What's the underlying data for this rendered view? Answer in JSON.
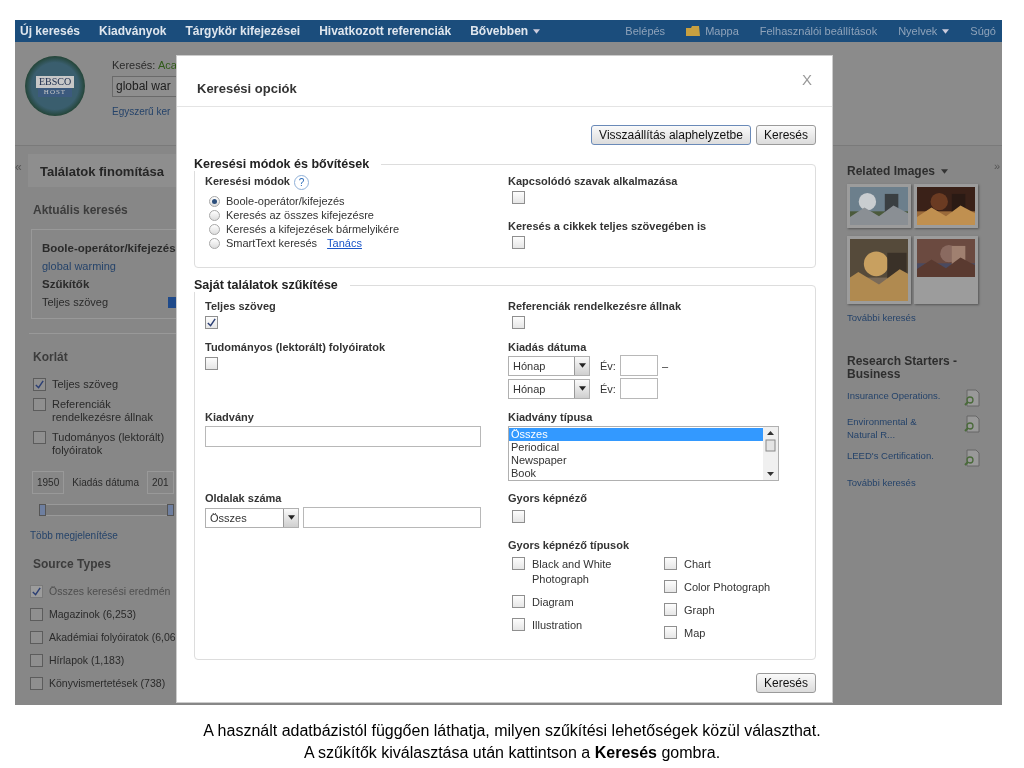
{
  "nav": {
    "left": [
      {
        "label": "Új keresés",
        "kind": "link"
      },
      {
        "label": "Kiadványok",
        "kind": "link"
      },
      {
        "label": "Tárgykör kifejezései",
        "kind": "link"
      },
      {
        "label": "Hivatkozott referenciák",
        "kind": "link"
      },
      {
        "label": "Bővebben",
        "kind": "menu"
      }
    ],
    "right": [
      {
        "label": "Belépés",
        "kind": "link"
      },
      {
        "label": "Mappa",
        "kind": "folder"
      },
      {
        "label": "Felhasználói beállítások",
        "kind": "link"
      },
      {
        "label": "Nyelvek",
        "kind": "menu"
      },
      {
        "label": "Súgó",
        "kind": "link"
      }
    ]
  },
  "header": {
    "logo": {
      "top": "EBSCO",
      "bottom": "HOST"
    },
    "search_label": "Keresés:",
    "database": "Aca",
    "query": "global war",
    "basic_link": "Egyszerű ker"
  },
  "sidebar": {
    "collapse": "«",
    "title": "Találatok finomítása",
    "current": {
      "heading": "Aktuális keresés",
      "mode": "Boole-operátor/kifejezés",
      "query": "global warming",
      "limiters_heading": "Szűkítők",
      "limiter": "Teljes szöveg"
    },
    "limit": {
      "heading": "Korlát",
      "items": [
        {
          "label": "Teljes szöveg",
          "checked": true
        },
        {
          "label": "Referenciák rendelkezésre állnak",
          "checked": false
        },
        {
          "label": "Tudományos (lektorált) folyóiratok",
          "checked": false
        }
      ],
      "date": {
        "from": "1950",
        "label": "Kiadás dátuma",
        "to": "201",
        "level": 1
      },
      "more": "Több megjelenítése"
    },
    "source_types": {
      "heading": "Source Types",
      "items": [
        {
          "label": "Összes keresési eredmén",
          "checked": true,
          "disabled": true
        },
        {
          "label": "Magazinok (6,253)",
          "checked": false,
          "disabled": false
        },
        {
          "label": "Akadémiai folyóiratok (6,06",
          "checked": false,
          "disabled": false
        },
        {
          "label": "Hírlapok (1,183)",
          "checked": false,
          "disabled": false
        },
        {
          "label": "Könyvismertetések (738)",
          "checked": false,
          "disabled": false
        }
      ]
    }
  },
  "right_panel": {
    "expand": "»",
    "related": {
      "heading": "Related Images",
      "more": "További keresés"
    },
    "starters": {
      "heading": "Research Starters - Business",
      "items": [
        {
          "label": "Insurance Operations."
        },
        {
          "label": "Environmental & Natural R..."
        },
        {
          "label": "LEED's Certification."
        }
      ],
      "more": "További keresés"
    }
  },
  "modal": {
    "title": "Keresési opciók",
    "close": "X",
    "reset_button": "Visszaállítás alaphelyzetbe",
    "search_button": "Keresés",
    "modes_section": {
      "legend": "Keresési módok és bővítések",
      "modes_label": "Keresési módok",
      "help": "?",
      "modes": [
        {
          "label": "Boole-operátor/kifejezés",
          "selected": true
        },
        {
          "label": "Keresés az összes kifejezésre",
          "selected": false
        },
        {
          "label": "Keresés a kifejezések bármelyikére",
          "selected": false
        },
        {
          "label": "SmartText keresés",
          "selected": false,
          "link": "Tanács"
        }
      ],
      "expanders": [
        {
          "label": "Kapcsolódó szavak alkalmazása",
          "checked": false
        },
        {
          "label": "Keresés a cikkek teljes szövegében is",
          "checked": false
        }
      ]
    },
    "limit_section": {
      "legend": "Saját találatok szűkítése",
      "full_text": {
        "label": "Teljes szöveg",
        "checked": true
      },
      "references": {
        "label": "Referenciák rendelkezésre állnak",
        "checked": false
      },
      "peer_reviewed": {
        "label": "Tudományos (lektorált) folyóiratok",
        "checked": false
      },
      "pub_date": {
        "label": "Kiadás dátuma",
        "rows": [
          {
            "month": "Hónap",
            "year_label": "Év:",
            "separator": "–"
          },
          {
            "month": "Hónap",
            "year_label": "Év:"
          }
        ]
      },
      "publication": {
        "label": "Kiadvány"
      },
      "pub_type": {
        "label": "Kiadvány típusa",
        "options": [
          {
            "label": "Összes",
            "selected": true
          },
          {
            "label": "Periodical",
            "selected": false
          },
          {
            "label": "Newspaper",
            "selected": false
          },
          {
            "label": "Book",
            "selected": false
          }
        ]
      },
      "pages": {
        "label": "Oldalak száma",
        "select": "Összes"
      },
      "quick_view": {
        "label": "Gyors képnéző",
        "checked": false
      },
      "image_types": {
        "label": "Gyors képnéző típusok",
        "columns": [
          [
            {
              "label": "Black and White Photograph",
              "checked": false
            },
            {
              "label": "Diagram",
              "checked": false
            },
            {
              "label": "Illustration",
              "checked": false
            }
          ],
          [
            {
              "label": "Chart",
              "checked": false
            },
            {
              "label": "Color Photograph",
              "checked": false
            },
            {
              "label": "Graph",
              "checked": false
            },
            {
              "label": "Map",
              "checked": false
            }
          ]
        ]
      }
    },
    "bottom_button": "Keresés"
  },
  "caption": [
    "A használt adatbázistól függően láthatja, milyen szűkítési lehetőségek közül választhat.",
    "A szűkítők kiválasztása után kattintson a **Keresés** gombra."
  ]
}
